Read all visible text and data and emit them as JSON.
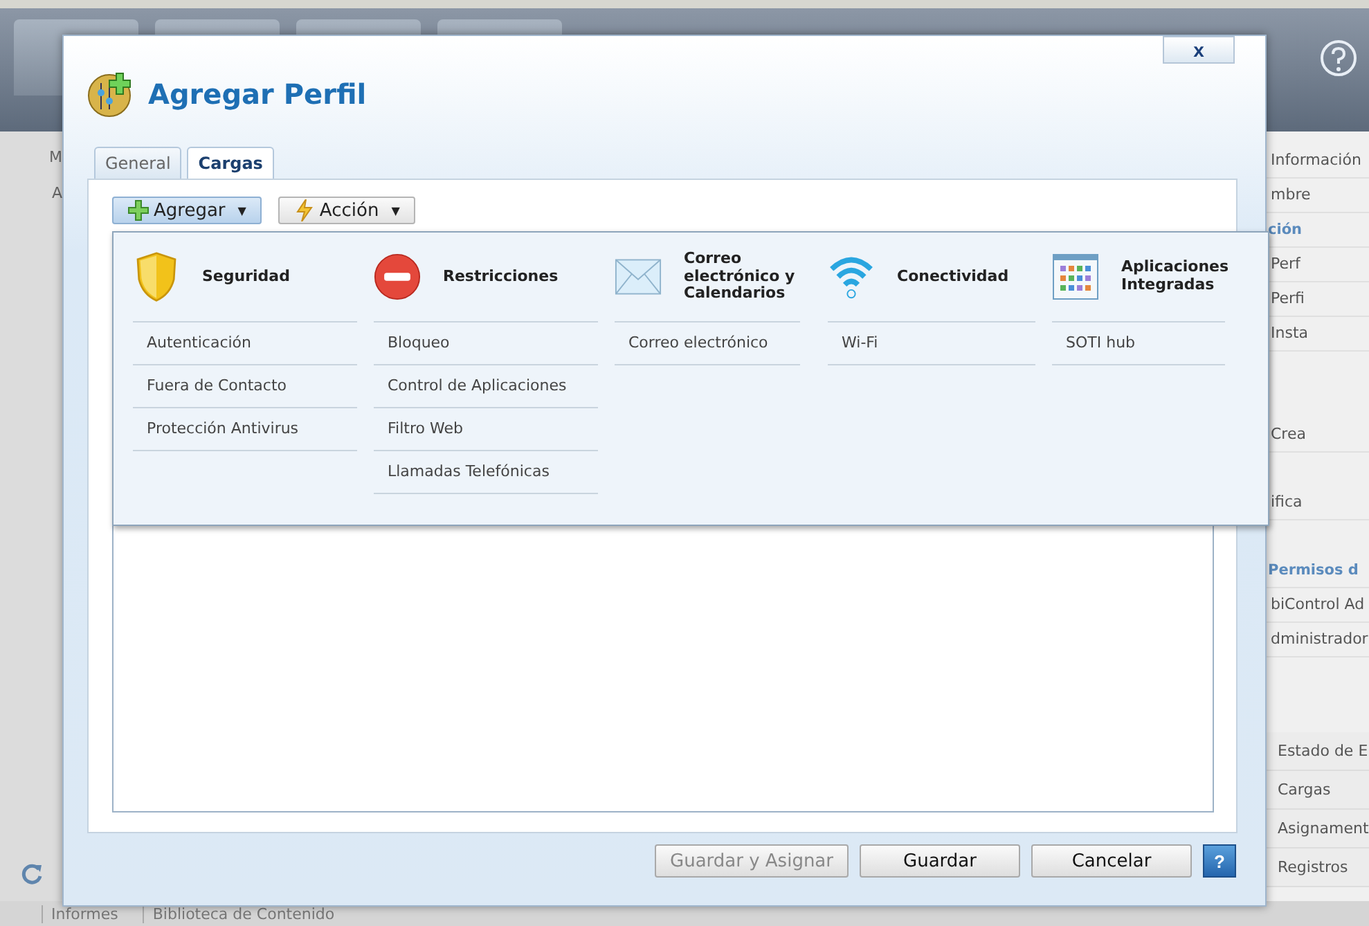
{
  "background": {
    "left_labels": [
      "M",
      "A"
    ],
    "right_panel": [
      {
        "text": "Información",
        "kind": "item"
      },
      {
        "text": "mbre",
        "kind": "item"
      },
      {
        "text": "ción",
        "kind": "heading"
      },
      {
        "text": "Perf",
        "kind": "item"
      },
      {
        "text": "Perfi",
        "kind": "item"
      },
      {
        "text": "Insta",
        "kind": "item"
      },
      {
        "kind": "gap"
      },
      {
        "kind": "gap"
      },
      {
        "text": "Crea",
        "kind": "item"
      },
      {
        "kind": "gap"
      },
      {
        "text": "ifica",
        "kind": "item"
      },
      {
        "kind": "gap"
      },
      {
        "text": "Permisos d",
        "kind": "heading"
      },
      {
        "text": "biControl Ad",
        "kind": "item"
      },
      {
        "text": "dministrador",
        "kind": "item"
      }
    ],
    "right_links": [
      "Estado de E",
      "Cargas",
      "Asignament",
      "Registros"
    ],
    "bottom_tabs": [
      "Informes",
      "Biblioteca de Contenido"
    ]
  },
  "dialog": {
    "title": "Agregar Perfil",
    "close": "x",
    "tabs": [
      {
        "label": "General",
        "selected": false
      },
      {
        "label": "Cargas",
        "selected": true
      }
    ],
    "toolbar": [
      {
        "label": "Agregar",
        "kind": "add",
        "expanded": true,
        "caret": "▼"
      },
      {
        "label": "Acción",
        "kind": "action",
        "expanded": false,
        "caret": "▼"
      }
    ],
    "menu": [
      {
        "title": "Seguridad",
        "kind": "shield",
        "items": [
          "Autenticación",
          "Fuera de Contacto",
          "Protección Antivirus"
        ]
      },
      {
        "title": "Restricciones",
        "kind": "stop",
        "items": [
          "Bloqueo",
          "Control de Aplicaciones",
          "Filtro Web",
          "Llamadas Telefónicas"
        ]
      },
      {
        "title": "Correo electrónico y Calendarios",
        "kind": "mail",
        "items": [
          "Correo electrónico"
        ]
      },
      {
        "title": "Conectividad",
        "kind": "wifi",
        "items": [
          "Wi-Fi"
        ]
      },
      {
        "title": "Aplicaciones Integradas",
        "kind": "apps",
        "items": [
          "SOTI hub"
        ]
      }
    ],
    "buttons": [
      {
        "label": "Guardar y Asignar",
        "disabled": true
      },
      {
        "label": "Guardar",
        "disabled": false
      },
      {
        "label": "Cancelar",
        "disabled": false
      }
    ],
    "help": "?"
  }
}
